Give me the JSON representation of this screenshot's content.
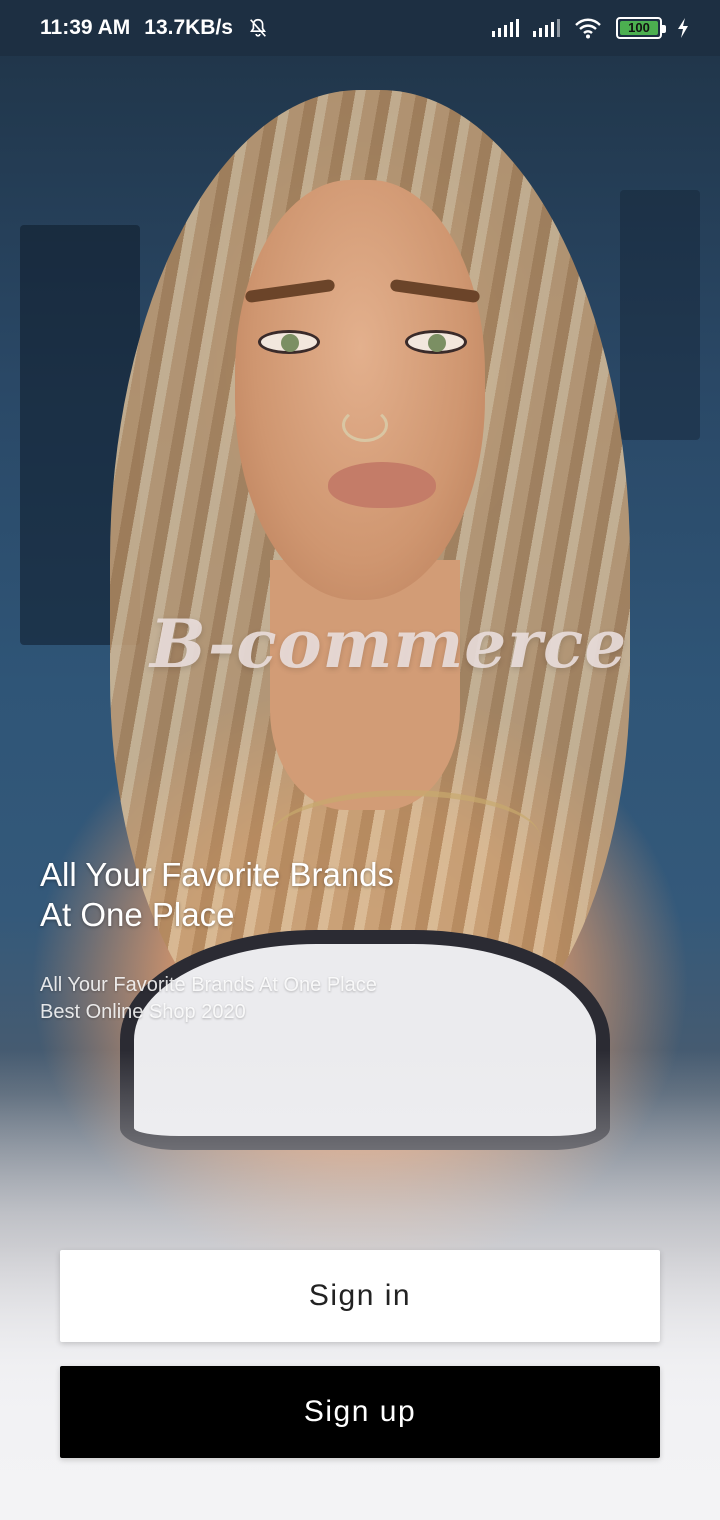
{
  "status_bar": {
    "time": "11:39 AM",
    "network_speed": "13.7KB/s",
    "battery_level": "100",
    "icons": [
      "bell-off-icon",
      "signal-icon",
      "signal-icon",
      "wifi-icon",
      "battery-icon",
      "charging-bolt-icon"
    ]
  },
  "brand": {
    "logo_text": "B-commerce"
  },
  "hero": {
    "headline_line1": "All Your Favorite Brands",
    "headline_line2": "At One Place",
    "sub_line1": "All Your Favorite Brands At One Place",
    "sub_line2": "Best Online Shop 2020"
  },
  "actions": {
    "signin_label": "Sign in",
    "signup_label": "Sign up"
  },
  "colors": {
    "status_bar_bg": "#1d2f42",
    "signin_bg": "#ffffff",
    "signup_bg": "#000000",
    "battery_green": "#4caf50"
  }
}
